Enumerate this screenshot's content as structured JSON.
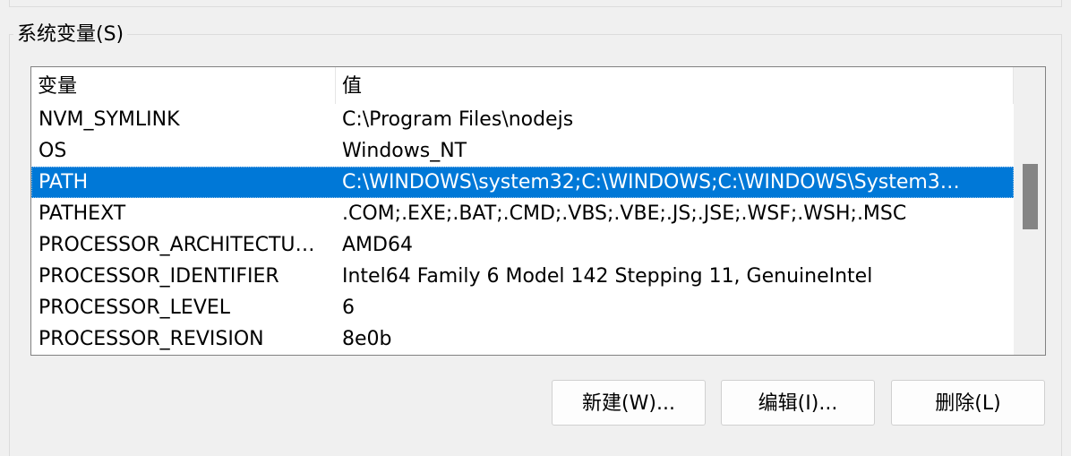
{
  "group": {
    "title": "系统变量(S)"
  },
  "list": {
    "columns": {
      "variable": "变量",
      "value": "值"
    },
    "rows": [
      {
        "name": "NVM_SYMLINK",
        "value": "C:\\Program Files\\nodejs",
        "selected": false
      },
      {
        "name": "OS",
        "value": "Windows_NT",
        "selected": false
      },
      {
        "name": "PATH",
        "value": "C:\\WINDOWS\\system32;C:\\WINDOWS;C:\\WINDOWS\\System3…",
        "selected": true
      },
      {
        "name": "PATHEXT",
        "value": ".COM;.EXE;.BAT;.CMD;.VBS;.VBE;.JS;.JSE;.WSF;.WSH;.MSC",
        "selected": false
      },
      {
        "name": "PROCESSOR_ARCHITECTU…",
        "value": "AMD64",
        "selected": false
      },
      {
        "name": "PROCESSOR_IDENTIFIER",
        "value": "Intel64 Family 6 Model 142 Stepping 11, GenuineIntel",
        "selected": false
      },
      {
        "name": "PROCESSOR_LEVEL",
        "value": "6",
        "selected": false
      },
      {
        "name": "PROCESSOR_REVISION",
        "value": "8e0b",
        "selected": false
      }
    ]
  },
  "buttons": {
    "new_label": "新建(W)...",
    "edit_label": "编辑(I)...",
    "delete_label": "删除(L)"
  },
  "colors": {
    "selection": "#0078d7",
    "background": "#f0f0f0",
    "scroll_thumb": "#858585"
  }
}
